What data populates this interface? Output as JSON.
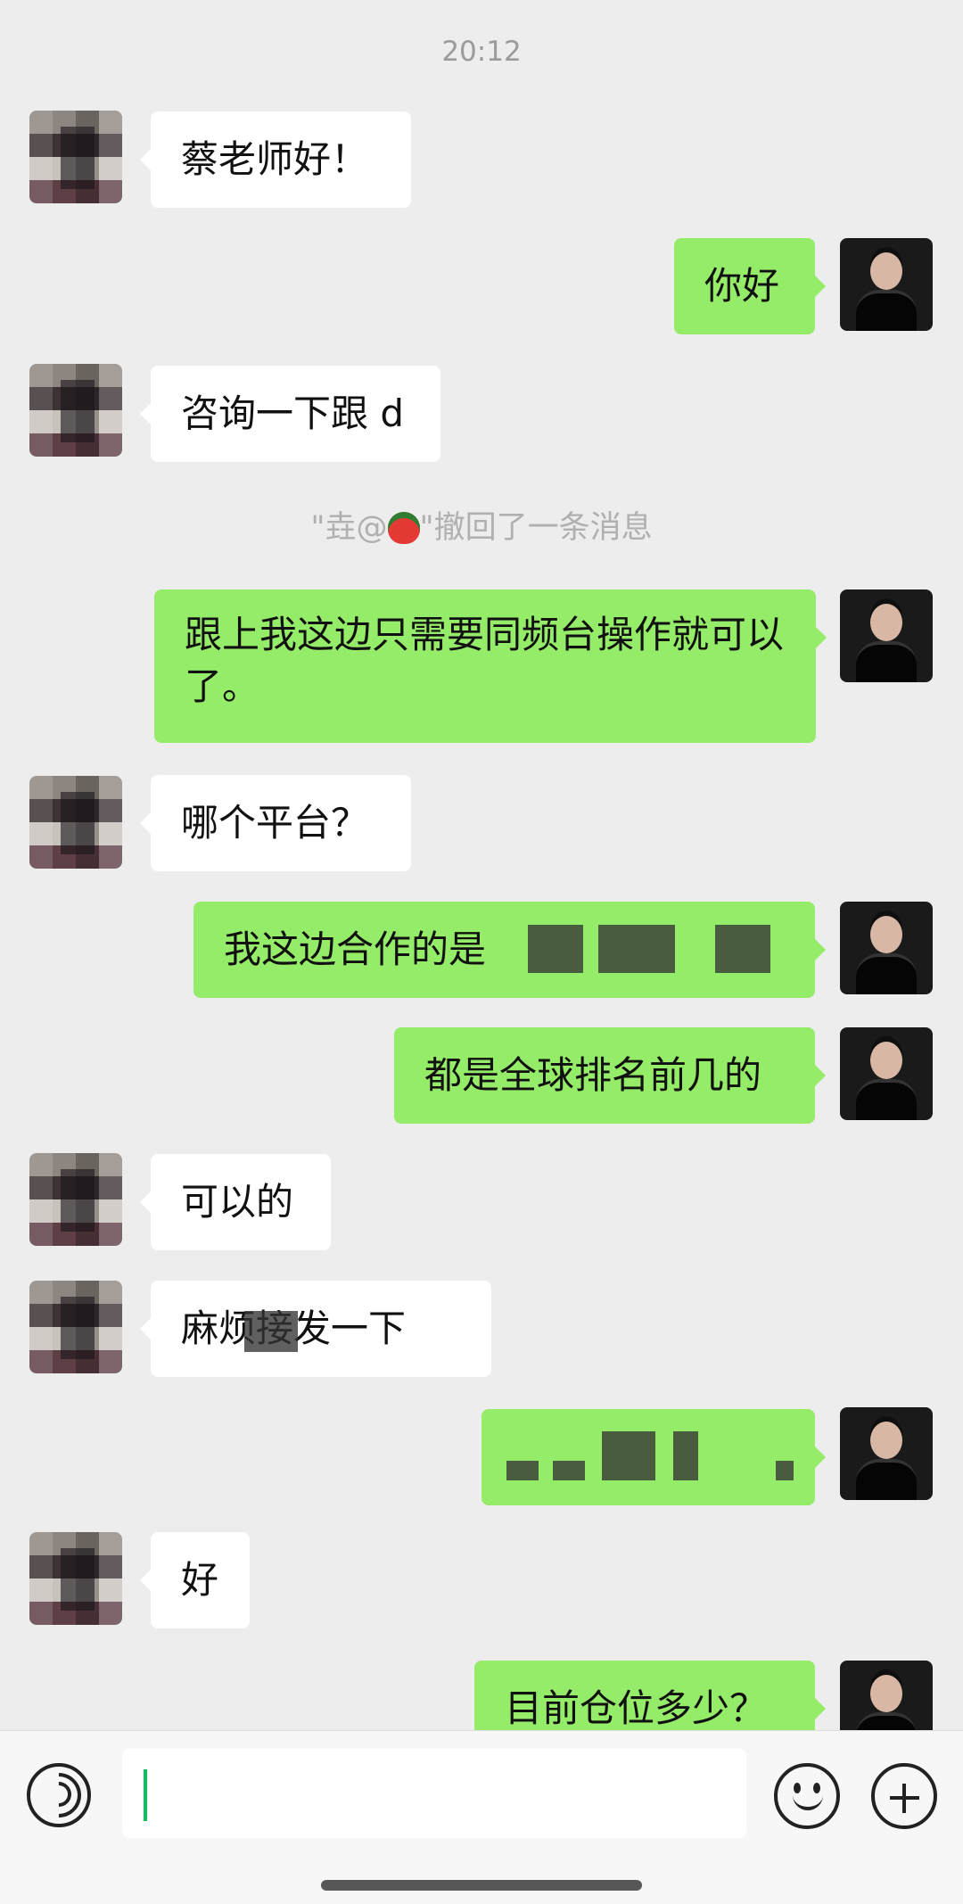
{
  "chat": {
    "timestamp": "20:12",
    "messages": [
      {
        "text": "蔡老师好！"
      },
      {
        "text": "你好"
      },
      {
        "text": "咨询一下跟 d"
      },
      {
        "text": "跟上我这边只需要同频台操作就可以了。"
      },
      {
        "text": "哪个平台？"
      },
      {
        "text": "我这边合作的是"
      },
      {
        "text": "都是全球排名前几的"
      },
      {
        "text": "可以的"
      },
      {
        "text": "麻烦",
        "text_after": "接发一下"
      },
      {
        "text": "好"
      },
      {
        "text": "目前仓位多少？"
      }
    ],
    "system_notice": {
      "prefix": "\"垚@",
      "suffix": "\"撤回了一条消息",
      "emoji": "strawberry-icon"
    }
  },
  "input_bar": {
    "voice_icon": "voice-icon",
    "emoji_icon": "emoji-icon",
    "plus_icon": "plus-icon"
  },
  "colors": {
    "background": "#ededed",
    "incoming_bubble": "#ffffff",
    "outgoing_bubble": "#95ec69",
    "text": "#111111",
    "cursor": "#07c160"
  }
}
